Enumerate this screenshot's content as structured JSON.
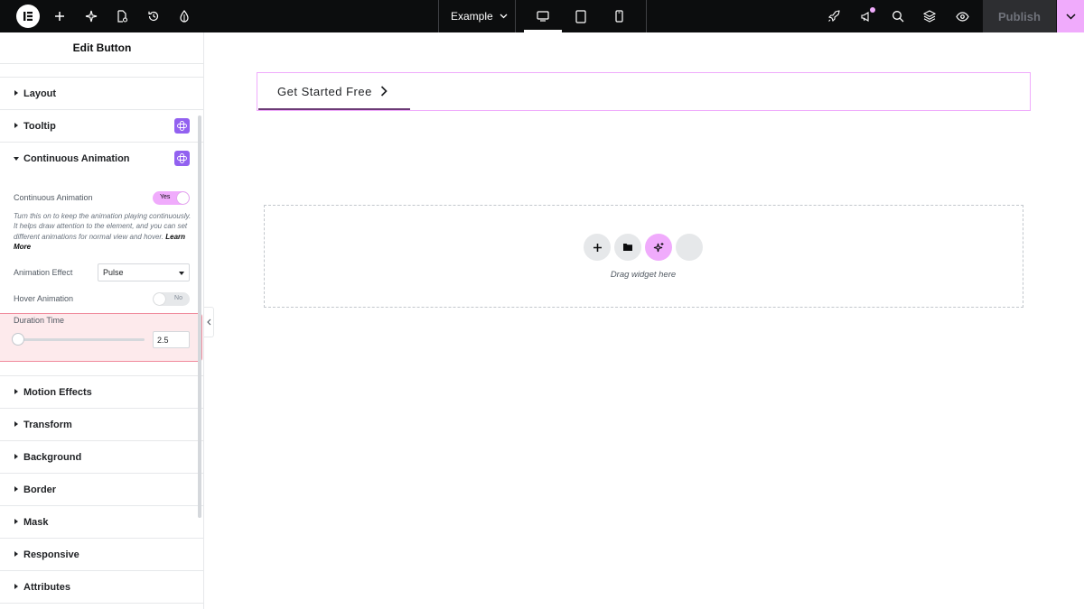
{
  "topbar": {
    "document_name": "Example",
    "publish_label": "Publish",
    "icons": [
      "elementor-logo-icon",
      "add-icon",
      "sparkle-icon",
      "page-settings-icon",
      "history-icon",
      "theme-icon",
      "desktop-icon",
      "tablet-icon",
      "mobile-icon",
      "rocket-icon",
      "announcements-icon",
      "search-icon",
      "layers-icon",
      "preview-eye-icon",
      "chevron-down-icon"
    ]
  },
  "panel": {
    "title": "Edit Button",
    "sections_top": [
      {
        "label": "Layout",
        "pro": false
      },
      {
        "label": "Tooltip",
        "pro": true
      },
      {
        "label": "Continuous Animation",
        "pro": true,
        "expanded": true
      }
    ],
    "continuous_animation": {
      "label": "Continuous Animation",
      "toggle": "Yes",
      "help_text": "Turn this on to keep the animation playing continuously. It helps draw attention to the element, and you can set different animations for normal view and hover.",
      "learn_more": "Learn More",
      "effect_label": "Animation Effect",
      "effect_value": "Pulse",
      "hover_label": "Hover Animation",
      "hover_toggle": "No",
      "duration_label": "Duration Time",
      "duration_value": "2.5"
    },
    "sections_bottom": [
      {
        "label": "Motion Effects"
      },
      {
        "label": "Transform"
      },
      {
        "label": "Background"
      },
      {
        "label": "Border"
      },
      {
        "label": "Mask"
      },
      {
        "label": "Responsive"
      },
      {
        "label": "Attributes"
      }
    ]
  },
  "canvas": {
    "button_text": "Get Started Free",
    "drop_hint": "Drag widget here"
  },
  "colors": {
    "accent_pink": "#f0abfc",
    "pro_purple": "#9261f0",
    "highlight_border": "#f08a9c",
    "topbar_bg": "#0c0d0e"
  }
}
